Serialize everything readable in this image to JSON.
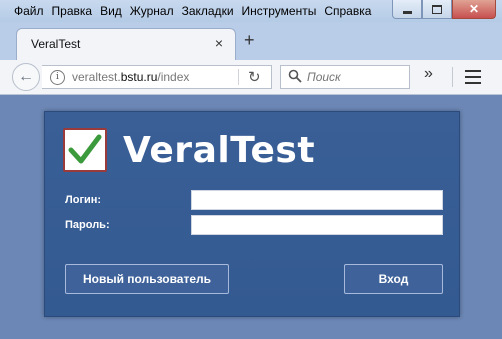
{
  "menu": [
    "Файл",
    "Правка",
    "Вид",
    "Журнал",
    "Закладки",
    "Инструменты",
    "Справка"
  ],
  "tab": {
    "title": "VeralTest",
    "close": "×",
    "new_tab": "+"
  },
  "nav": {
    "url_host": "veraltest.",
    "url_domain": "bstu.ru",
    "url_path": "/index",
    "search_placeholder": "Поиск",
    "overflow": "»"
  },
  "app": {
    "title": "VeralTest",
    "login_label": "Логин:",
    "login_value": "",
    "password_label": "Пароль:",
    "password_value": "",
    "new_user_button": "Новый пользователь",
    "enter_button": "Вход"
  },
  "colors": {
    "panel": "#3a5f97",
    "background": "#6c87b5",
    "checkmark": "#3b9a3b"
  }
}
